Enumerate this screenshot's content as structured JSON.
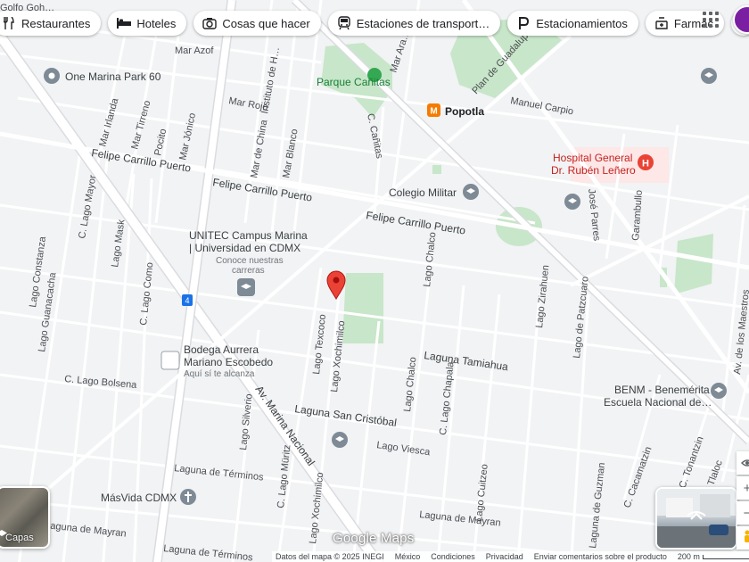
{
  "chips": [
    {
      "label": "Restaurantes",
      "icon": "restaurant-icon",
      "name": "chip-restaurants"
    },
    {
      "label": "Hoteles",
      "icon": "bed-icon",
      "name": "chip-hotels"
    },
    {
      "label": "Cosas que hacer",
      "icon": "camera-icon",
      "name": "chip-things-to-do"
    },
    {
      "label": "Estaciones de transport…",
      "icon": "transit-icon",
      "name": "chip-transit"
    },
    {
      "label": "Estacionamientos",
      "icon": "parking-icon",
      "name": "chip-parking"
    },
    {
      "label": "Farmac",
      "icon": "pharmacy-icon",
      "name": "chip-pharmacy"
    }
  ],
  "labels": {
    "one_marina": "One Marina Park 60",
    "parque_canitas": "Parque Cañitas",
    "popotla": "Popotla",
    "manuel_carpio": "Manuel Carpio",
    "plan_guadalupe": "Plan de Guadalupe",
    "hospital_1": "Hospital General",
    "hospital_2": "Dr. Rubén Leñero",
    "colegio_militar": "Colegio Militar",
    "fcp_1": "Felipe Carrillo Puerto",
    "fcp_2": "Felipe Carrillo Puerto",
    "fcp_3": "Felipe Carrillo Puerto",
    "unitec_1": "UNITEC Campus Marina",
    "unitec_2": "| Universidad en CDMX",
    "unitec_3": "Conoce nuestras",
    "unitec_4": "carreras",
    "bodega_1": "Bodega Aurrera",
    "bodega_2": "Mariano Escobedo",
    "bodega_3": "Aquí sí te alcanza",
    "benm_1": "BENM - Benemérita",
    "benm_2": "Escuela Nacional de…",
    "masvida": "MásVida CDMX",
    "laguna_tamiahua": "Laguna Tamiahua",
    "laguna_san_cristobal": "Laguna San Cristóbal",
    "lago_viesca": "Lago Viesca",
    "laguna_terminos_1": "Laguna de Términos",
    "laguna_terminos_2": "Laguna de Términos",
    "laguna_mayran_1": "Laguna de Mayran",
    "laguna_mayran_2": "Laguna de Mayran",
    "c_lago_bolsena": "C. Lago Bolsena",
    "av_marina_nacional": "Av. Marina Nacional",
    "mar_azof": "Mar Azof",
    "mar_rojo": "Mar Rojo",
    "mar_irlanda": "Mar Irlanda",
    "mar_tirreno": "Mar Tirreno",
    "pocito": "Pocito",
    "mar_jonico": "Mar Jónico",
    "mar_de_china": "Mar de China",
    "mar_blanco": "Mar Blanco",
    "instituto": "Instituto de H…",
    "mar_ara": "Mar Ara…",
    "c_canitas": "C. Cañitas",
    "lago_constanza": "Lago Constanza",
    "lago_guanacacha": "Lago Guanacacha",
    "c_lago_mayor": "C. Lago Mayor",
    "lago_mask": "Lago Mask",
    "c_lago_como": "C. Lago Como",
    "lago_texcoco": "Lago Texcoco",
    "lago_xochimilco": "Lago Xochimilco",
    "lago_chalco_1": "Lago Chalco",
    "lago_chalco_2": "Lago Chalco",
    "lago_chapala": "C. Lago Chapala",
    "lago_zirahuen": "Lago Zirahuen",
    "lago_patzcuaro": "Lago de Patzcuaro",
    "lago_silverio": "Lago Silverio",
    "c_lago_muritz": "C. Lago Müritz",
    "lago_xochimilco_2": "Lago Xochimilco",
    "lago_cuitzeo": "Lago Cuitzeo",
    "laguna_guzman": "Laguna de Guzman",
    "c_cacamatzin": "C. Cacamatzin",
    "c_tonantzin": "C. Tonantzin",
    "tlaloc": "Tlaloc",
    "jose_parres": "José Parres",
    "garambullo": "Garambullo",
    "av_maestros": "Av. de los Maestros",
    "golfo": "Golfo Goh…",
    "route_4": "4"
  },
  "layers_label": "Capas",
  "logo": "Google Maps",
  "footer": {
    "map_data": "Datos del mapa © 2025 INEGI",
    "country": "México",
    "terms": "Condiciones",
    "privacy": "Privacidad",
    "feedback": "Enviar comentarios sobre el producto",
    "scale": "200 m"
  },
  "colors": {
    "park": "#c8e6c9",
    "water": "#aadaff",
    "road": "#ffffff",
    "major_road": "#ffffff",
    "hospital": "#fde7e7",
    "pin": "#ea4335"
  }
}
